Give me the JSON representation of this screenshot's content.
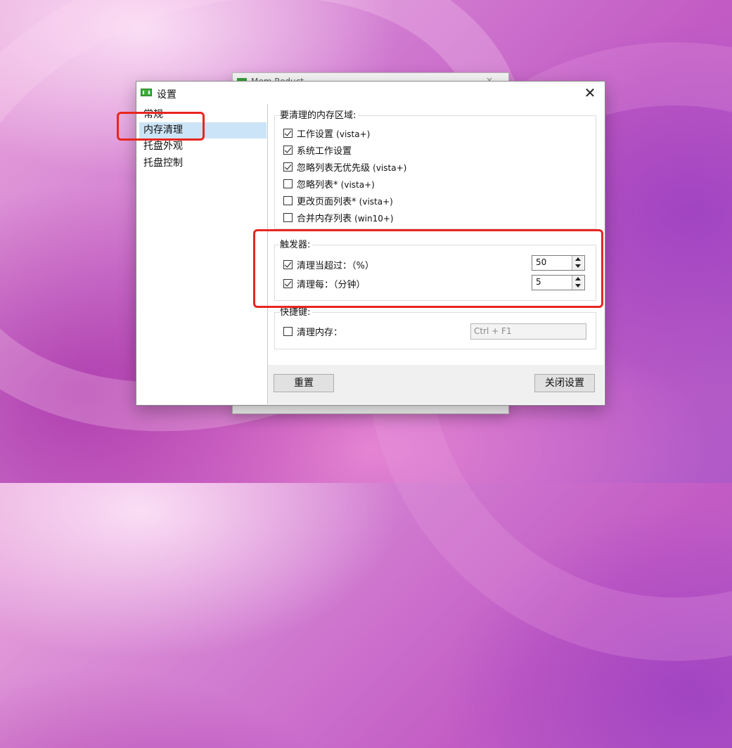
{
  "background_window": {
    "title": "Mem Reduct",
    "close": "×"
  },
  "dialog": {
    "title": "设置",
    "close_glyph": "✕",
    "sidebar": [
      {
        "label": "常规"
      },
      {
        "label": "内存清理"
      },
      {
        "label": "托盘外观"
      },
      {
        "label": "托盘控制"
      }
    ],
    "selected_index": 1,
    "regions": {
      "label": "要清理的内存区域:",
      "items": [
        {
          "text": "工作设置",
          "suffix": "(vista+)",
          "checked": true
        },
        {
          "text": "系统工作设置",
          "suffix": "",
          "checked": true
        },
        {
          "text": "忽略列表无优先级",
          "suffix": "(vista+)",
          "checked": true
        },
        {
          "text": "忽略列表*",
          "suffix": "(vista+)",
          "checked": false
        },
        {
          "text": "更改页面列表*",
          "suffix": "(vista+)",
          "checked": false
        },
        {
          "text": "合并内存列表",
          "suffix": "(win10+)",
          "checked": false
        }
      ]
    },
    "triggers": {
      "label": "触发器:",
      "percent": {
        "text": "清理当超过：（%）",
        "checked": true,
        "value": "50"
      },
      "minutes": {
        "text": "清理每：（分钟）",
        "checked": true,
        "value": "5"
      }
    },
    "hotkey": {
      "label": "快捷键:",
      "item": {
        "text": "清理内存：",
        "checked": false
      },
      "placeholder": "Ctrl + F1"
    },
    "buttons": {
      "reset": "重置",
      "close_settings": "关闭设置"
    }
  },
  "colors": {
    "highlight": "#e8261f",
    "selection": "#cce4f7",
    "app_icon": "#3fae3f"
  }
}
